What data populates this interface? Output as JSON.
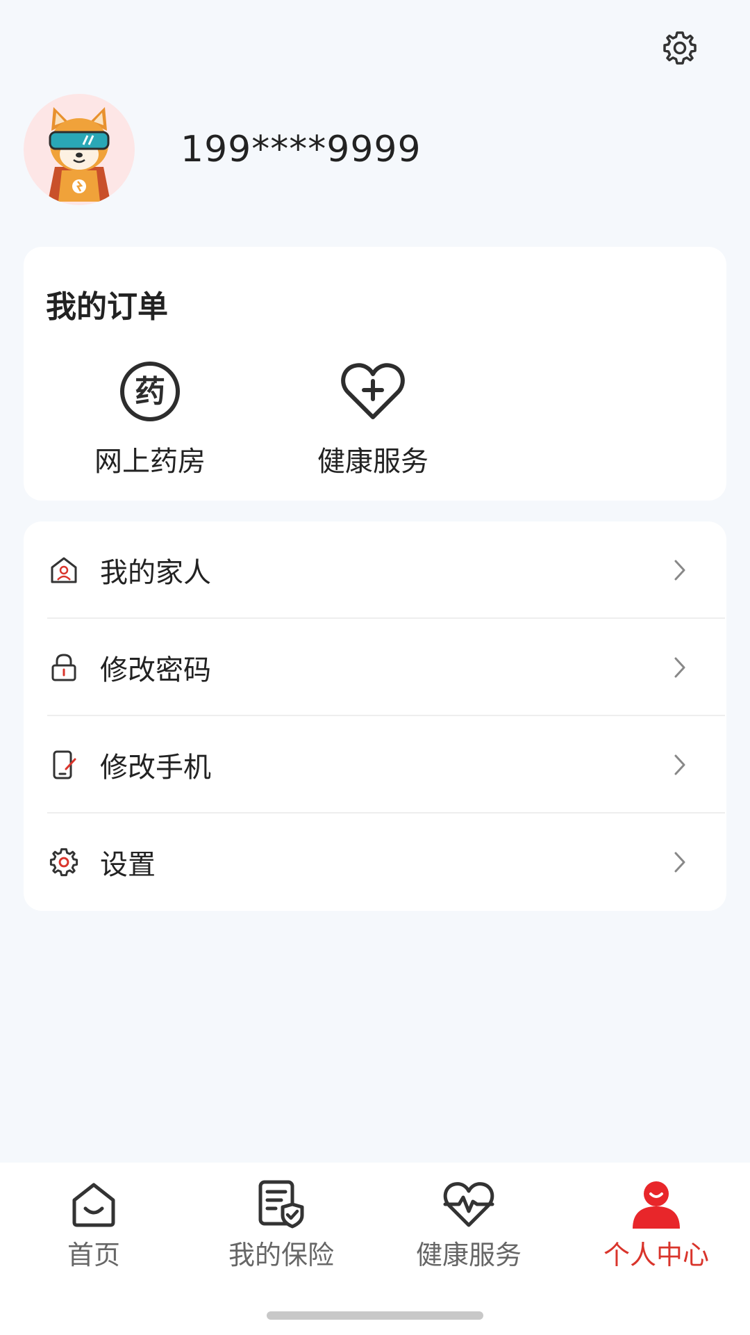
{
  "header": {
    "settings_icon": "gear-icon"
  },
  "profile": {
    "avatar_icon": "shiba-dog-avatar",
    "phone": "199****9999"
  },
  "orders": {
    "title": "我的订单",
    "items": [
      {
        "label": "网上药房",
        "icon": "pharmacy-icon"
      },
      {
        "label": "健康服务",
        "icon": "heart-plus-icon"
      }
    ]
  },
  "menu": {
    "items": [
      {
        "label": "我的家人",
        "icon": "family-icon"
      },
      {
        "label": "修改密码",
        "icon": "lock-icon"
      },
      {
        "label": "修改手机",
        "icon": "phone-edit-icon"
      },
      {
        "label": "设置",
        "icon": "gear-icon"
      }
    ]
  },
  "tabbar": {
    "items": [
      {
        "label": "首页",
        "icon": "home-icon",
        "active": false
      },
      {
        "label": "我的保险",
        "icon": "policy-icon",
        "active": false
      },
      {
        "label": "健康服务",
        "icon": "heartbeat-icon",
        "active": false
      },
      {
        "label": "个人中心",
        "icon": "user-icon",
        "active": true
      }
    ]
  },
  "colors": {
    "accent": "#d9342b",
    "background": "#f5f8fc",
    "card": "#ffffff"
  }
}
